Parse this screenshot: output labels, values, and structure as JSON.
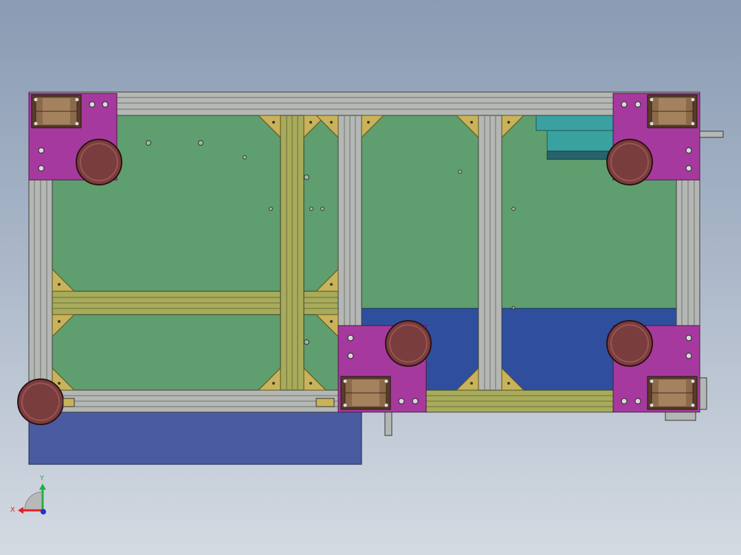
{
  "viewport": {
    "background_top": "#8a9bb3",
    "background_bottom": "#d4dae2"
  },
  "colors": {
    "plate_green": "#5f9e6e",
    "extrusion_gray": "#b4b7b4",
    "extrusion_olive": "#a7ab5a",
    "bracket_gold": "#c8b35a",
    "magenta_plate": "#a6399e",
    "wheel_red": "#7a3d3d",
    "bearing_brown": "#8a6a4a",
    "blue_panel": "#2f4f9e",
    "blue_panel_light": "#4a5ba0",
    "teal_block": "#3aa1a1",
    "teal_dark": "#27636a",
    "axis_x": "#e02020",
    "axis_y": "#20b040",
    "axis_z": "#2030d0"
  },
  "triad": {
    "x_label": "X",
    "y_label": "Y"
  },
  "icons": {
    "triad": "view-orientation-triad-icon"
  }
}
